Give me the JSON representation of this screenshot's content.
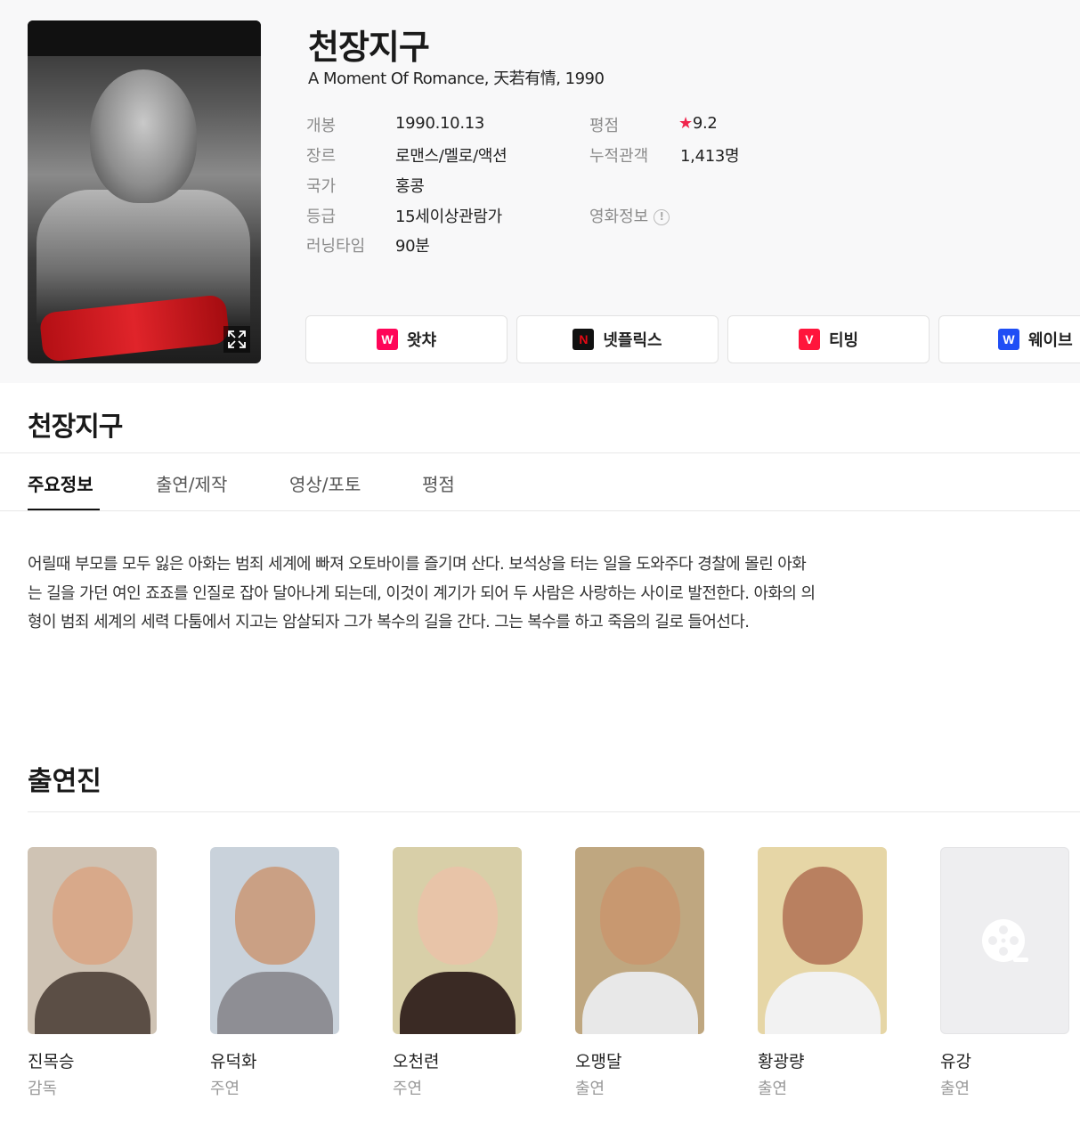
{
  "movie": {
    "title": "천장지구",
    "subtitle": "A Moment Of Romance, 天若有情, 1990"
  },
  "info": {
    "release_label": "개봉",
    "release_value": "1990.10.13",
    "genre_label": "장르",
    "genre_value": "로맨스/멜로/액션",
    "country_label": "국가",
    "country_value": "홍콩",
    "rating_label": "등급",
    "rating_value": "15세이상관람가",
    "runtime_label": "러닝타임",
    "runtime_value": "90분",
    "score_label": "평점",
    "score_star": "★",
    "score_value": "9.2",
    "audience_label": "누적관객",
    "audience_value": "1,413명",
    "movie_info_label": "영화정보",
    "movie_info_icon": "!"
  },
  "ott": [
    {
      "label": "왓챠",
      "logo": "W",
      "color": "#ff0558",
      "icon": "watcha-logo"
    },
    {
      "label": "넷플릭스",
      "logo": "N",
      "color": "#e50914",
      "icon": "netflix-logo"
    },
    {
      "label": "티빙",
      "logo": "V",
      "color": "#ff153c",
      "icon": "tving-logo"
    },
    {
      "label": "웨이브",
      "logo": "W",
      "color": "#1f4ef5",
      "icon": "wavve-logo"
    }
  ],
  "section_title": "천장지구",
  "tabs": [
    "주요정보",
    "출연/제작",
    "영상/포토",
    "평점"
  ],
  "synopsis": {
    "line1": "어릴때 부모를 모두 잃은 아화는 범죄 세계에 빠져 오토바이를 즐기며 산다. 보석상을 터는 일을 도와주다 경찰에 몰린 아화",
    "line2": "는 길을 가던 여인 죠죠를 인질로 잡아 달아나게 되는데, 이것이 계기가 되어 두 사람은 사랑하는 사이로 발전한다. 아화의 의",
    "line3": "형이 범죄 세계의 세력 다툼에서 지고는 암살되자 그가 복수의 길을 간다. 그는 복수를 하고 죽음의 길로 들어선다."
  },
  "cast_title": "출연진",
  "cast": [
    {
      "name": "진목승",
      "role": "감독",
      "bg": "#cfc3b4",
      "skin": "#d8a98a",
      "cloth": "#5b4e45"
    },
    {
      "name": "유덕화",
      "role": "주연",
      "bg": "#c9d2db",
      "skin": "#caa084",
      "cloth": "#8e8e94"
    },
    {
      "name": "오천련",
      "role": "주연",
      "bg": "#d8cfa8",
      "skin": "#e8c4a8",
      "cloth": "#3a2a24"
    },
    {
      "name": "오맹달",
      "role": "출연",
      "bg": "#bfa780",
      "skin": "#c89870",
      "cloth": "#e8e8e8"
    },
    {
      "name": "황광량",
      "role": "출연",
      "bg": "#e6d6a6",
      "skin": "#b98060",
      "cloth": "#f2f2f2"
    },
    {
      "name": "유강",
      "role": "출연",
      "bg": "#eeeef0",
      "skin": "",
      "cloth": ""
    }
  ]
}
